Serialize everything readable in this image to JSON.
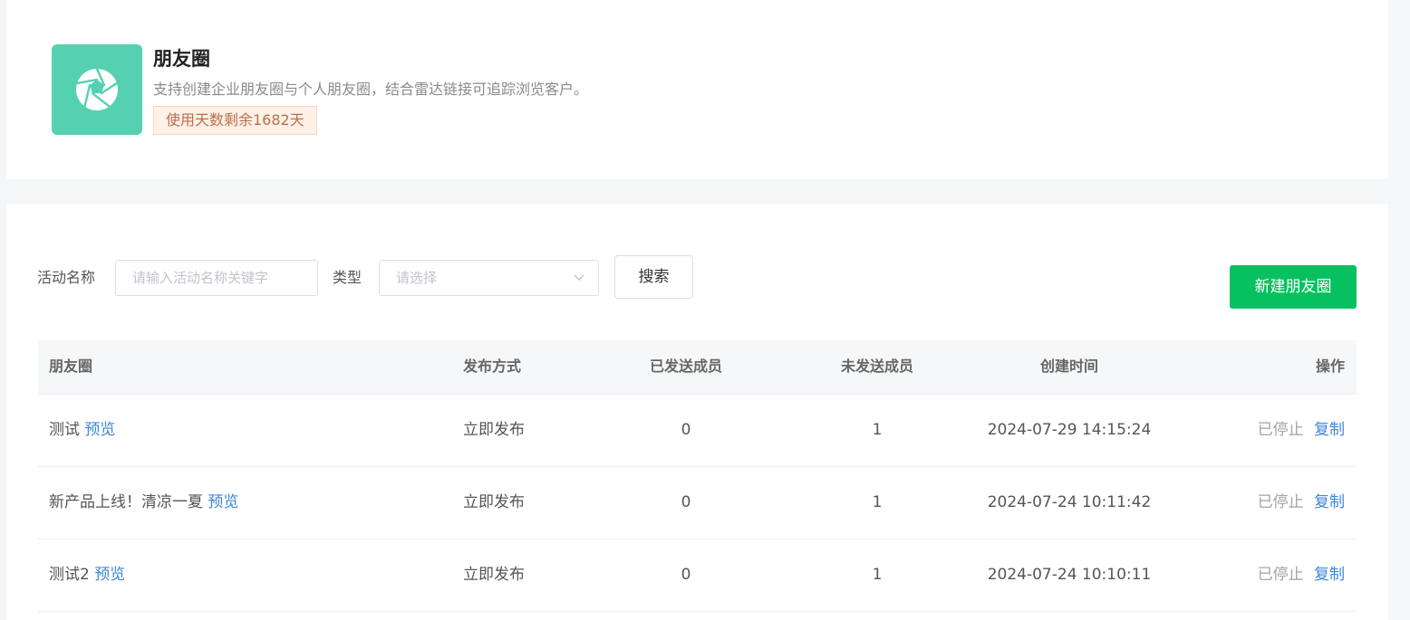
{
  "app": {
    "title": "朋友圈",
    "description": "支持创建企业朋友圈与个人朋友圈，结合雷达链接可追踪浏览客户。",
    "days_badge": "使用天数剩余1682天",
    "icon": "aperture-icon",
    "icon_bg": "#55d1b2"
  },
  "filters": {
    "name_label": "活动名称",
    "name_placeholder": "请输入活动名称关键字",
    "name_value": "",
    "type_label": "类型",
    "type_placeholder": "请选择",
    "search_label": "搜索",
    "create_label": "新建朋友圈",
    "create_color": "#07c160"
  },
  "table": {
    "headers": {
      "name": "朋友圈",
      "method": "发布方式",
      "sent": "已发送成员",
      "unsent": "未发送成员",
      "created": "创建时间",
      "ops": "操作"
    },
    "rows": [
      {
        "name": "测试",
        "preview": "预览",
        "method": "立即发布",
        "sent": "0",
        "unsent": "1",
        "created": "2024-07-29 14:15:24",
        "status": "已停止",
        "copy": "复制"
      },
      {
        "name": "新产品上线！清凉一夏",
        "preview": "预览",
        "method": "立即发布",
        "sent": "0",
        "unsent": "1",
        "created": "2024-07-24 10:11:42",
        "status": "已停止",
        "copy": "复制"
      },
      {
        "name": "测试2",
        "preview": "预览",
        "method": "立即发布",
        "sent": "0",
        "unsent": "1",
        "created": "2024-07-24 10:10:11",
        "status": "已停止",
        "copy": "复制"
      }
    ]
  }
}
